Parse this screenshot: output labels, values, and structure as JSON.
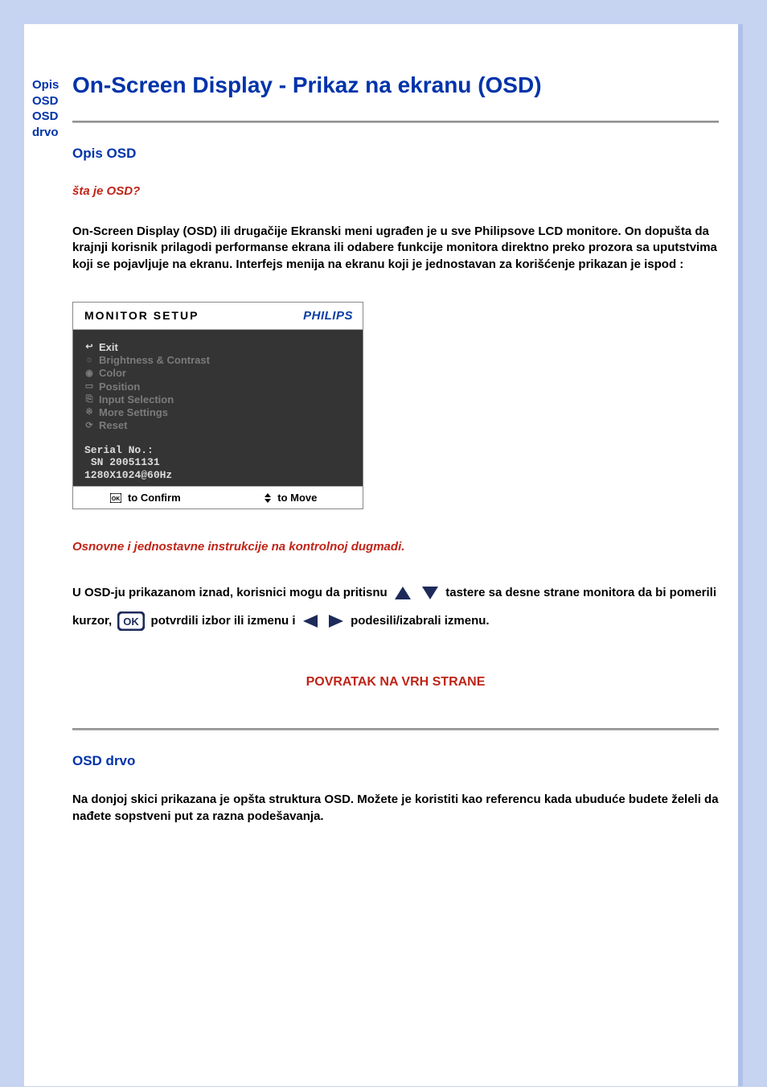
{
  "sidebar": {
    "link1": "Opis OSD",
    "link2": "OSD drvo"
  },
  "title": "On-Screen Display - Prikaz na ekranu (OSD)",
  "section1": {
    "heading": "Opis OSD",
    "subhead": "šta je OSD?",
    "paragraph": "On-Screen Display (OSD) ili drugačije Ekranski meni ugrađen je u sve Philipsove LCD monitore. On dopušta da krajnji korisnik prilagodi performanse ekrana ili odabere funkcije monitora direktno preko prozora sa uputstvima koji se pojavljuje na ekranu. Interfejs menija na ekranu koji je jednostavan za korišćenje prikazan je ispod :"
  },
  "osd": {
    "title": "MONITOR SETUP",
    "brand": "PHILIPS",
    "items": [
      {
        "label": "Exit",
        "selected": true,
        "icon": "back-icon"
      },
      {
        "label": "Brightness & Contrast",
        "selected": false,
        "icon": "sun-icon"
      },
      {
        "label": "Color",
        "selected": false,
        "icon": "circle-icon"
      },
      {
        "label": "Position",
        "selected": false,
        "icon": "rect-icon"
      },
      {
        "label": "Input Selection",
        "selected": false,
        "icon": "io-icon"
      },
      {
        "label": "More Settings",
        "selected": false,
        "icon": "gear-icon"
      },
      {
        "label": "Reset",
        "selected": false,
        "icon": "reset-icon"
      }
    ],
    "serial_label": "Serial No.:",
    "serial_value": "SN 20051131",
    "resolution": "1280X1024@60Hz",
    "footer_confirm": "to Confirm",
    "footer_move": "to Move"
  },
  "instructions": {
    "subhead": "Osnovne i jednostavne instrukcije na kontrolnoj dugmadi.",
    "part1": "U OSD-ju prikazanom iznad, korisnici mogu da pritisnu ",
    "part2": " tastere sa desne strane monitora da bi pomerili kurzor,",
    "part3": " potvrdili izbor ili izmenu i ",
    "part4": "podesili/izabrali izmenu."
  },
  "back_top": "POVRATAK NA VRH STRANE",
  "section2": {
    "heading": "OSD drvo",
    "paragraph": "Na donjoj skici prikazana je opšta struktura OSD. Možete je koristiti kao referencu kada ubuduće budete želeli da nađete sopstveni put za razna podešavanja."
  }
}
